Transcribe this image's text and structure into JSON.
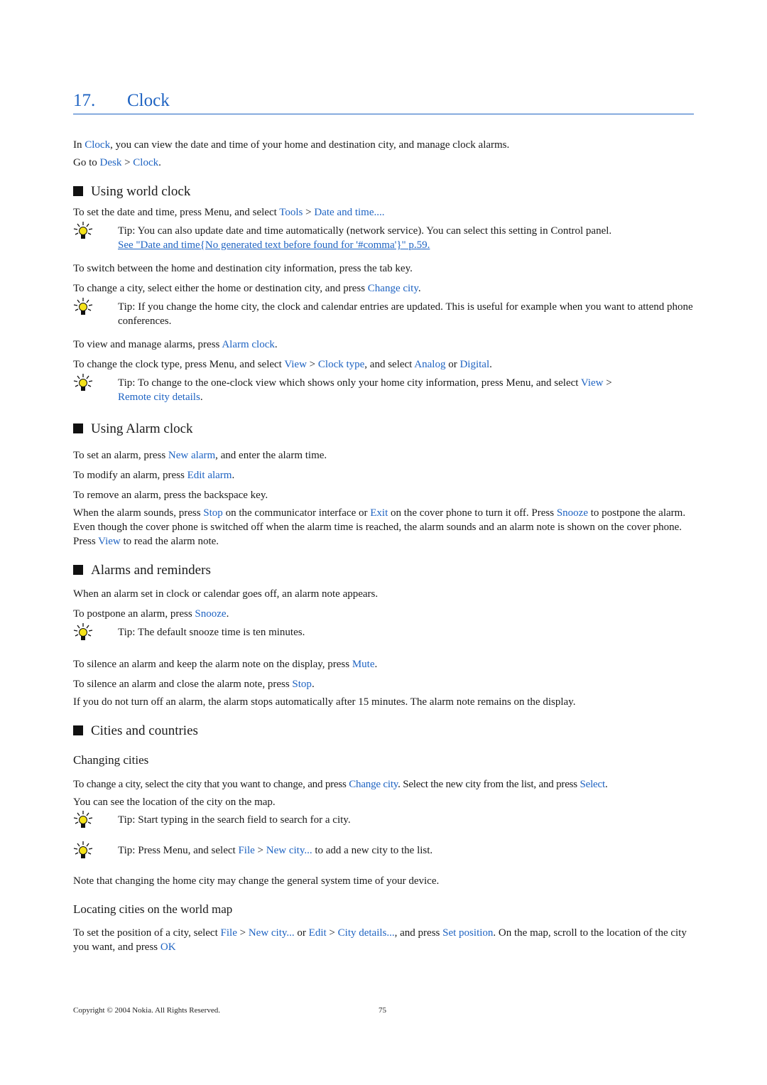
{
  "chapter": {
    "number": "17.",
    "title": "Clock"
  },
  "intro": {
    "p1": [
      "In ",
      "Clock",
      ", you can view the date and time of your home and destination city, and manage clock alarms."
    ],
    "p2": [
      "Go to ",
      "Desk",
      " > ",
      "Clock",
      "."
    ]
  },
  "sections": {
    "world_clock": {
      "heading": "Using world clock",
      "p1": [
        "To set the date and time, press Menu, and select ",
        "Tools",
        " > ",
        "Date and time...."
      ],
      "tip1": {
        "label": "Tip:",
        "text": " You can also update date and time automatically (network service). You can select this setting in Control panel. ",
        "link": "See \"Date and time{No generated text before found for '#comma'}\" p.59."
      },
      "p2": "To switch between the home and destination city information, press the tab key.",
      "p3": [
        "To change a city, select either the home or destination city, and press ",
        "Change city",
        "."
      ],
      "tip2": {
        "label": "Tip:",
        "text": " If you change the home city, the clock and calendar entries are updated. This is useful for example when you want to attend phone conferences."
      },
      "p4": [
        "To view and manage alarms, press ",
        "Alarm clock",
        "."
      ],
      "p5": [
        "To change the clock type, press Menu, and select ",
        "View",
        " > ",
        "Clock type",
        ", and select ",
        "Analog",
        " or ",
        "Digital",
        "."
      ],
      "tip3": {
        "label": "Tip:",
        "text": " To change to the one-clock view which shows only your home city information, press Menu, and select ",
        "l1": "View",
        "sep": " > ",
        "l2": "Remote city details",
        "end": "."
      }
    },
    "alarm_clock": {
      "heading": "Using Alarm clock",
      "p1": [
        "To set an alarm, press ",
        "New alarm",
        ", and enter the alarm time."
      ],
      "p2": [
        "To modify an alarm, press ",
        "Edit alarm",
        "."
      ],
      "p3": "To remove an alarm, press the backspace key.",
      "p4": [
        "When the alarm sounds, press ",
        "Stop",
        " on the communicator interface or ",
        "Exit",
        " on the cover phone to turn it off. Press ",
        "Snooze",
        " to postpone the alarm. Even though the cover phone is switched off when the alarm time is reached, the alarm sounds and an alarm note is shown on the cover phone. Press ",
        "View",
        " to read the alarm note."
      ]
    },
    "reminders": {
      "heading": "Alarms and reminders",
      "p1": "When an alarm set in clock or calendar goes off, an alarm note appears.",
      "p2": [
        "To postpone an alarm, press ",
        "Snooze",
        "."
      ],
      "tip1": {
        "label": "Tip:",
        "text": " The default snooze time is ten minutes."
      },
      "p3": [
        "To silence an alarm and keep the alarm note on the display, press ",
        "Mute",
        "."
      ],
      "p4": [
        "To silence an alarm and close the alarm note, press ",
        "Stop",
        "."
      ],
      "p5": "If you do not turn off an alarm, the alarm stops automatically after 15 minutes. The alarm note remains on the display."
    },
    "cities": {
      "heading": "Cities and countries",
      "sub1": "Changing cities",
      "p1": [
        "To change a city, select the city that you want to change, and press ",
        "Change city",
        ". Select the new city from the list, and press ",
        "Select",
        "."
      ],
      "p2": "You can see the location of the city on the map.",
      "tip1": {
        "label": "Tip:",
        "text": " Start typing in the search field to search for a city."
      },
      "tip2": {
        "label": "Tip:",
        "text": " Press Menu, and select ",
        "l1": "File",
        "sep": " > ",
        "l2": "New city...",
        "end": " to add a new city to the list."
      },
      "p3": "Note that changing the home city may change the general system time of your device.",
      "sub2": "Locating cities on the world map",
      "p4": [
        "To set the position of a city, select ",
        "File",
        " > ",
        "New city...",
        " or ",
        "Edit",
        " > ",
        "City details...",
        ", and press ",
        "Set position",
        ". On the map, scroll to the location of the city you want, and press ",
        "OK",
        ""
      ]
    }
  },
  "footer": {
    "copyright": "Copyright © 2004 Nokia. All Rights Reserved.",
    "page": "75"
  },
  "colors": {
    "link": "#1e63c2",
    "text": "#1a1a1a"
  }
}
